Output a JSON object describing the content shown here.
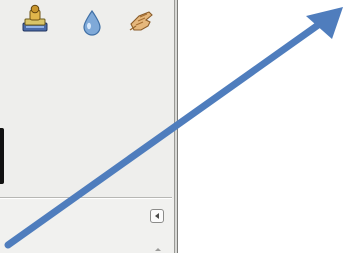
{
  "toolbar": {
    "icons": [
      "stamp-icon",
      "ink-drop-icon",
      "smudge-icon"
    ]
  },
  "colors": {
    "panel_bg": "#eeeeec",
    "arrow": "#4f7dbd",
    "canvas_bg": "#ffffff"
  },
  "lower_panel": {
    "icons": [
      "collapse-left-icon",
      "scroll-up-icon"
    ]
  }
}
